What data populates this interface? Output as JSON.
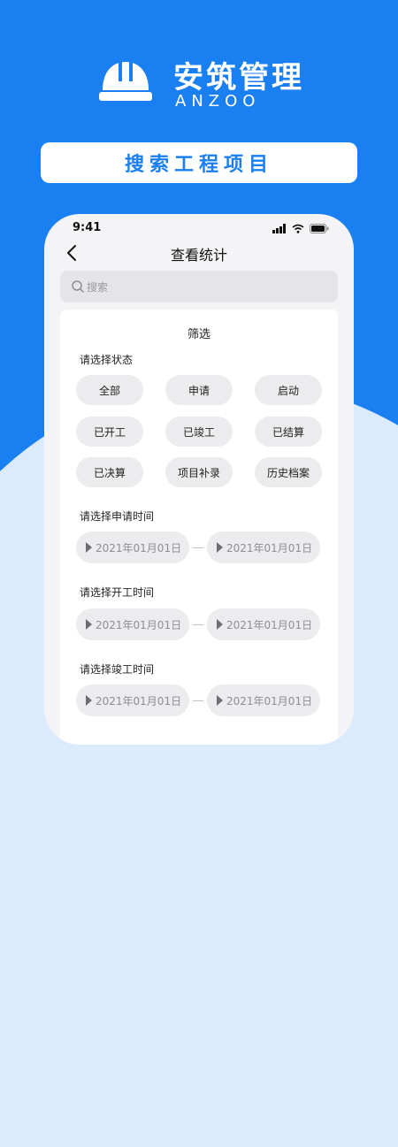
{
  "brand": {
    "title": "安筑管理",
    "subtitle": "ANZOO"
  },
  "banner": {
    "text": "搜索工程项目"
  },
  "status_bar": {
    "time": "9:41"
  },
  "nav": {
    "title": "查看统计"
  },
  "search": {
    "placeholder": "搜索"
  },
  "filter": {
    "title": "筛选",
    "status_label": "请选择状态",
    "status_options": [
      "全部",
      "申请",
      "启动",
      "已开工",
      "已竣工",
      "已结算",
      "已决算",
      "项目补录",
      "历史档案"
    ],
    "sections": [
      {
        "label": "请选择申请时间",
        "start": "2021年01月01日",
        "end": "2021年01月01日"
      },
      {
        "label": "请选择开工时间",
        "start": "2021年01月01日",
        "end": "2021年01月01日"
      },
      {
        "label": "请选择竣工时间",
        "start": "2021年01月01日",
        "end": "2021年01月01日"
      }
    ]
  },
  "colors": {
    "brand_blue": "#1a7ff0",
    "light_blue": "#dcebfb",
    "chip_gray": "#ececee"
  },
  "icons": [
    "helmet-icon",
    "back-chevron-icon",
    "search-icon",
    "signal-icon",
    "wifi-icon",
    "battery-icon",
    "triangle-icon"
  ]
}
